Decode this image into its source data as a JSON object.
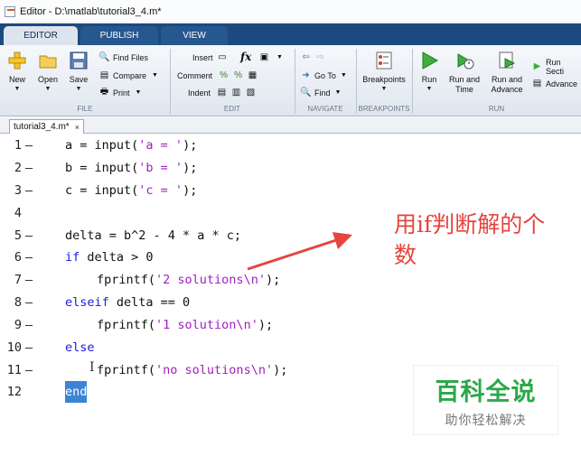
{
  "window": {
    "title": "Editor - D:\\matlab\\tutorial3_4.m*"
  },
  "tabs": [
    {
      "label": "EDITOR",
      "active": true
    },
    {
      "label": "PUBLISH",
      "active": false
    },
    {
      "label": "VIEW",
      "active": false
    }
  ],
  "ribbon": {
    "file": {
      "group_label": "FILE",
      "new_label": "New",
      "open_label": "Open",
      "save_label": "Save",
      "find_files_label": "Find Files",
      "compare_label": "Compare",
      "print_label": "Print"
    },
    "edit": {
      "group_label": "EDIT",
      "insert_label": "Insert",
      "comment_label": "Comment",
      "indent_label": "Indent",
      "fx_label": "fx"
    },
    "navigate": {
      "group_label": "NAVIGATE",
      "goto_label": "Go To",
      "find_label": "Find"
    },
    "breakpoints": {
      "group_label": "BREAKPOINTS",
      "breakpoints_label": "Breakpoints"
    },
    "run": {
      "group_label": "RUN",
      "run_label": "Run",
      "run_time_label_1": "Run and",
      "run_time_label_2": "Time",
      "run_advance_label_1": "Run and",
      "run_advance_label_2": "Advance",
      "run_section_label": "Run Secti",
      "advance_label": "Advance"
    }
  },
  "file_tab": {
    "label": "tutorial3_4.m*",
    "close": "×"
  },
  "code_lines": [
    {
      "n": "1",
      "dash": "—",
      "text": "a = input('a = ');"
    },
    {
      "n": "2",
      "dash": "—",
      "text": "b = input('b = ');"
    },
    {
      "n": "3",
      "dash": "—",
      "text": "c = input('c = ');"
    },
    {
      "n": "4",
      "dash": "",
      "text": ""
    },
    {
      "n": "5",
      "dash": "—",
      "text": "delta = b^2 - 4 * a * c;"
    },
    {
      "n": "6",
      "dash": "—",
      "text": "if delta > 0"
    },
    {
      "n": "7",
      "dash": "—",
      "text": "fprintf('2 solutions\\n');"
    },
    {
      "n": "8",
      "dash": "—",
      "text": "elseif delta == 0"
    },
    {
      "n": "9",
      "dash": "—",
      "text": "fprintf('1 solution\\n');"
    },
    {
      "n": "10",
      "dash": "—",
      "text": "else"
    },
    {
      "n": "11",
      "dash": "—",
      "text": "fprintf('no solutions\\n');"
    },
    {
      "n": "12",
      "dash": "",
      "text": "end"
    }
  ],
  "code_parts": {
    "l1": {
      "pre": "a = input(",
      "str": "'a = '",
      "post": ");"
    },
    "l2": {
      "pre": "b = input(",
      "str": "'b = '",
      "post": ");"
    },
    "l3": {
      "pre": "c = input(",
      "str": "'c = '",
      "post": ");"
    },
    "l5": {
      "pre": "delta = b^2 - 4 * a * c;"
    },
    "l6": {
      "kw": "if",
      "post": " delta > 0"
    },
    "l7": {
      "pre": "fprintf(",
      "str": "'2 solutions\\n'",
      "post": ");"
    },
    "l8": {
      "kw": "elseif",
      "post": " delta == 0"
    },
    "l9": {
      "pre": "fprintf(",
      "str": "'1 solution\\n'",
      "post": ");"
    },
    "l10": {
      "kw": "else"
    },
    "l11": {
      "pre": "fprintf(",
      "str": "'no solutions\\n'",
      "post": ");"
    },
    "l12": {
      "kw": "end"
    }
  },
  "annotation": {
    "line1": "用if判断解的个",
    "line2": "数"
  },
  "watermark": {
    "main": "百科全说",
    "sub": "助你轻松解决"
  },
  "colors": {
    "keyword": "#1a1ae6",
    "string": "#a020c0",
    "annotation": "#e6443e",
    "ribbon_tab_bar": "#1c4a80",
    "selection": "#3b84d6",
    "watermark": "#2ba84a"
  }
}
